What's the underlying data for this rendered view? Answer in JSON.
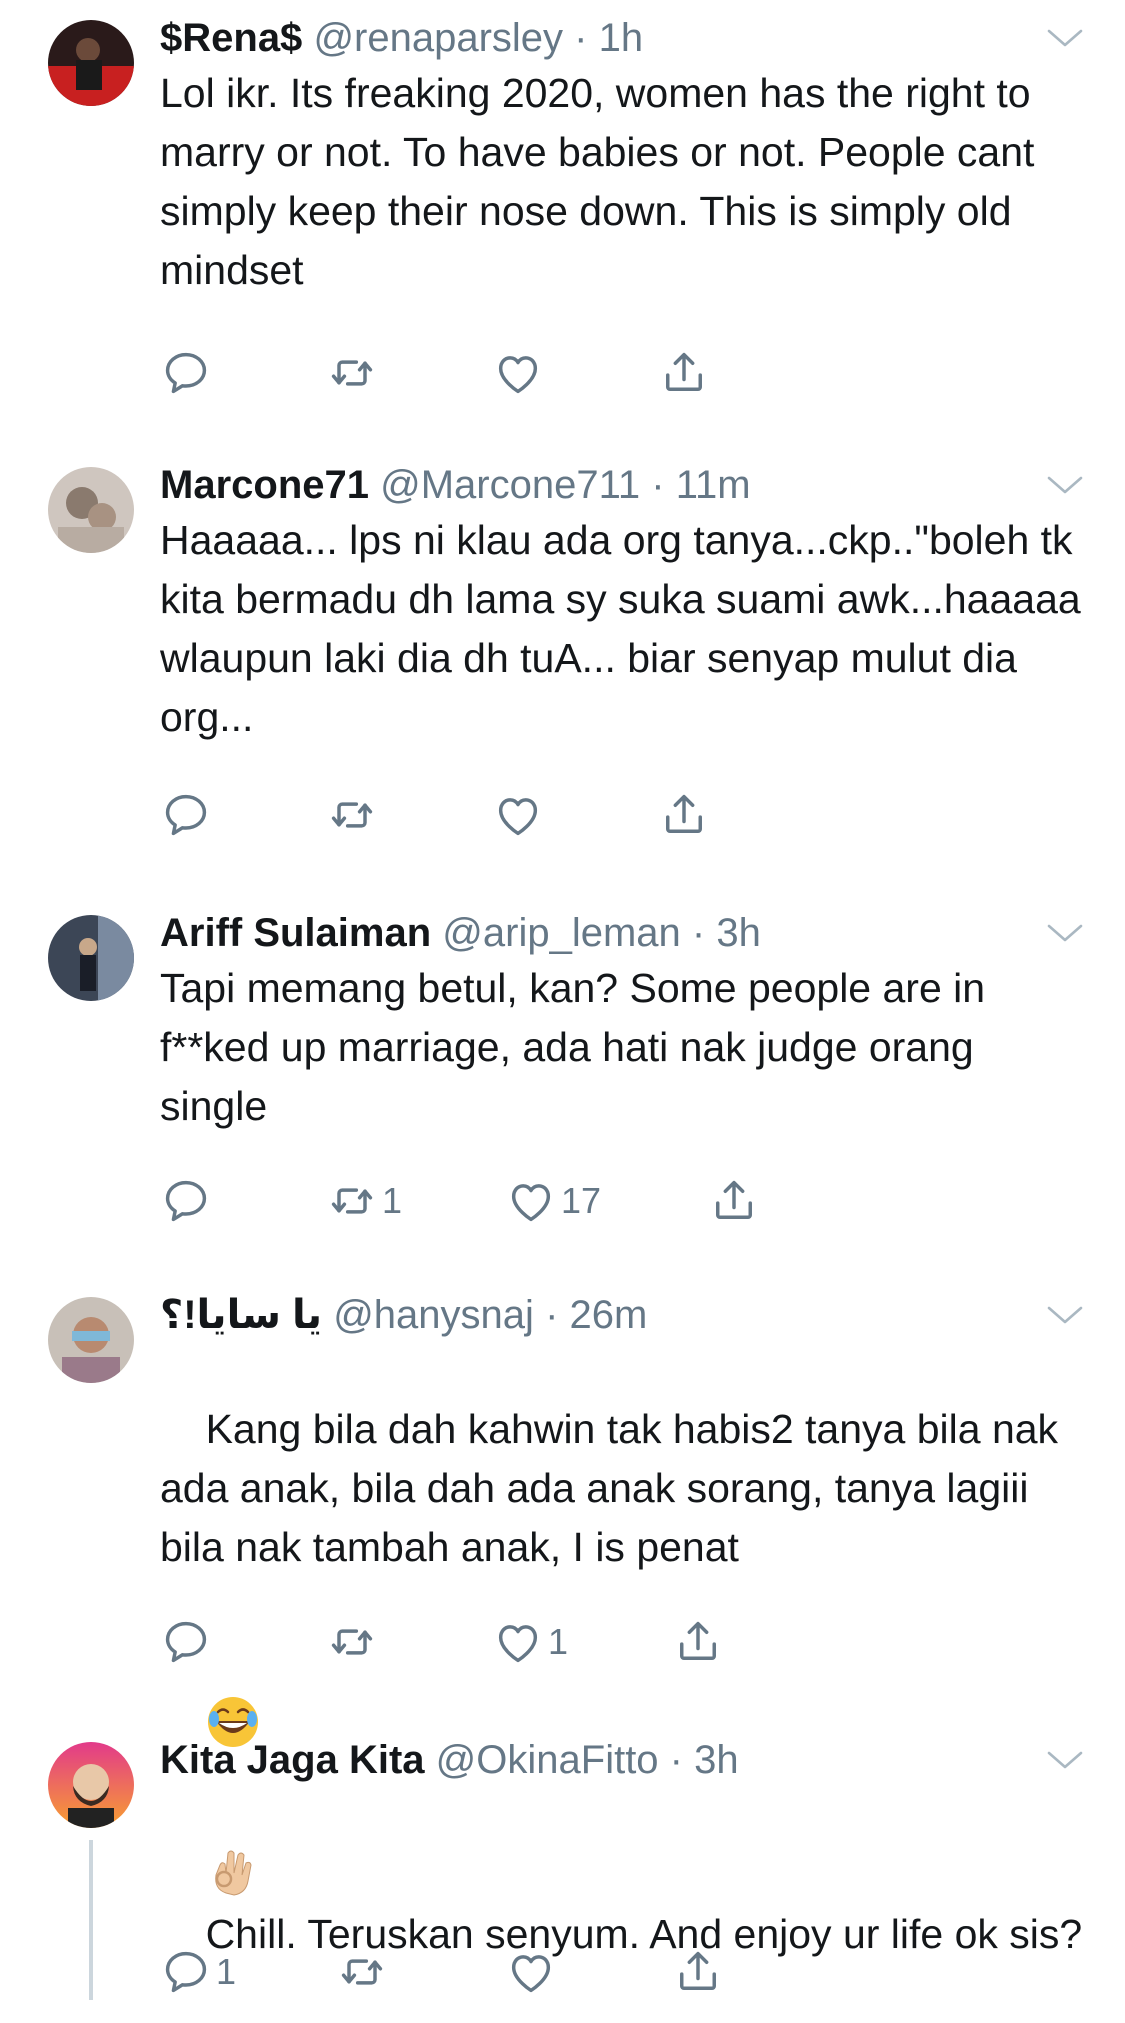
{
  "tweets": [
    {
      "name": "$Rena$",
      "handle": "@renaparsley",
      "sep": "·",
      "time": "1h",
      "text": "Lol ikr. Its freaking 2020, women has the right to marry or not. To have babies or not. People cant simply keep their nose down. This is simply old mindset",
      "counts": {
        "reply": "",
        "retweet": "",
        "like": ""
      }
    },
    {
      "name": "Marcone71",
      "handle": "@Marcone711",
      "sep": "·",
      "time": "11m",
      "text": "Haaaaa... lps ni klau ada org tanya...ckp..\"boleh tk kita bermadu dh lama sy suka suami awk...haaaaa wlaupun laki dia dh tuA... biar senyap mulut dia org...",
      "counts": {
        "reply": "",
        "retweet": "",
        "like": ""
      }
    },
    {
      "name": "Ariff Sulaiman",
      "handle": "@arip_leman",
      "sep": "·",
      "time": "3h",
      "text": "Tapi memang betul, kan? Some people are in f**ked up marriage, ada hati nak judge orang single",
      "counts": {
        "reply": "",
        "retweet": "1",
        "like": "17"
      }
    },
    {
      "name": "يا سايا!؟",
      "handle": "@hanysnaj",
      "sep": "·",
      "time": "26m",
      "text": "Kang bila dah kahwin tak habis2 tanya bila nak ada anak, bila dah ada anak sorang, tanya lagiii bila nak tambah anak, I is penat",
      "counts": {
        "reply": "",
        "retweet": "",
        "like": "1"
      }
    },
    {
      "name": "Kita Jaga Kita",
      "handle": "@OkinaFitto",
      "sep": "·",
      "time": "3h",
      "text": "Chill. Teruskan senyum. And enjoy ur life ok sis?",
      "counts": {
        "reply": "1",
        "retweet": "",
        "like": ""
      }
    }
  ],
  "icons": {
    "reply": "reply-icon",
    "retweet": "retweet-icon",
    "like": "heart-icon",
    "share": "share-icon",
    "more": "chevron-down-icon"
  },
  "colors": {
    "text": "#14171a",
    "secondary": "#657786",
    "icon": "#657786"
  }
}
